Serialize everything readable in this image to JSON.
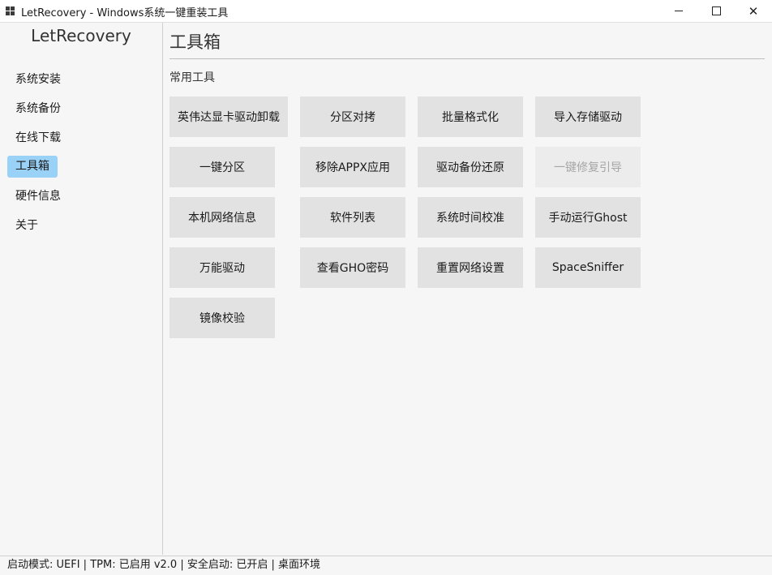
{
  "window": {
    "title": "LetRecovery - Windows系统一键重装工具",
    "app_icon": "windows-logo-icon",
    "controls": {
      "minimize": "minimize-icon",
      "maximize": "maximize-icon",
      "close": "✕"
    }
  },
  "sidebar": {
    "brand": "LetRecovery",
    "items": [
      {
        "label": "系统安装"
      },
      {
        "label": "系统备份"
      },
      {
        "label": "在线下载"
      },
      {
        "label": "工具箱",
        "active": true
      },
      {
        "label": "硬件信息"
      },
      {
        "label": "关于"
      }
    ],
    "active_color": "#99d1f7"
  },
  "main": {
    "title": "工具箱",
    "section_label": "常用工具",
    "tools": [
      {
        "label": "英伟达显卡驱动卸载"
      },
      {
        "label": "分区对拷"
      },
      {
        "label": "批量格式化"
      },
      {
        "label": "导入存储驱动"
      },
      {
        "label": "一键分区"
      },
      {
        "label": "移除APPX应用"
      },
      {
        "label": "驱动备份还原"
      },
      {
        "label": "一键修复引导",
        "disabled": true
      },
      {
        "label": "本机网络信息"
      },
      {
        "label": "软件列表"
      },
      {
        "label": "系统时间校准"
      },
      {
        "label": "手动运行Ghost"
      },
      {
        "label": "万能驱动"
      },
      {
        "label": "查看GHO密码"
      },
      {
        "label": "重置网络设置"
      },
      {
        "label": "SpaceSniffer"
      },
      {
        "label": "镜像校验"
      }
    ]
  },
  "status_bar": {
    "text": "启动模式: UEFI | TPM: 已启用 v2.0 | 安全启动: 已开启 | 桌面环境"
  }
}
